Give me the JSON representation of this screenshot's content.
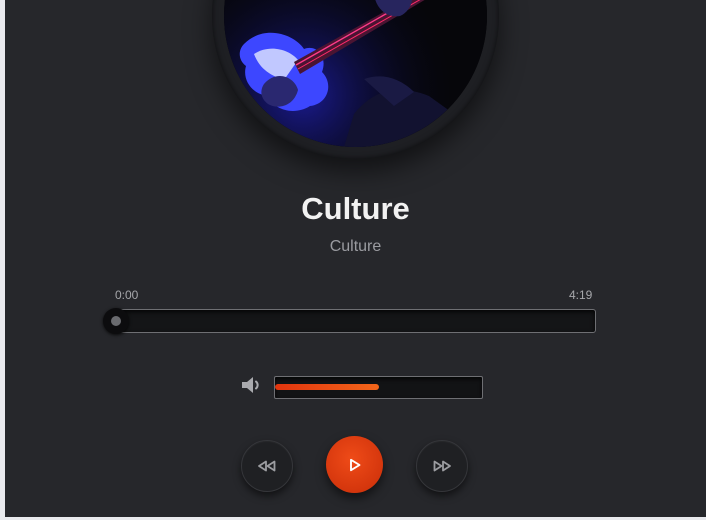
{
  "track": {
    "title": "Culture",
    "artist": "Culture"
  },
  "progress": {
    "current_time": "0:00",
    "total_time": "4:19",
    "fraction": 0
  },
  "volume": {
    "fraction": 0.5
  },
  "controls": {
    "rewind_icon": "rewind-icon",
    "play_icon": "play-icon",
    "forward_icon": "fast-forward-icon",
    "volume_icon": "volume-icon"
  },
  "colors": {
    "accent": "#e8440f",
    "background": "#26272b",
    "title": "#f2f2f2",
    "muted_text": "#9a9ba0"
  }
}
